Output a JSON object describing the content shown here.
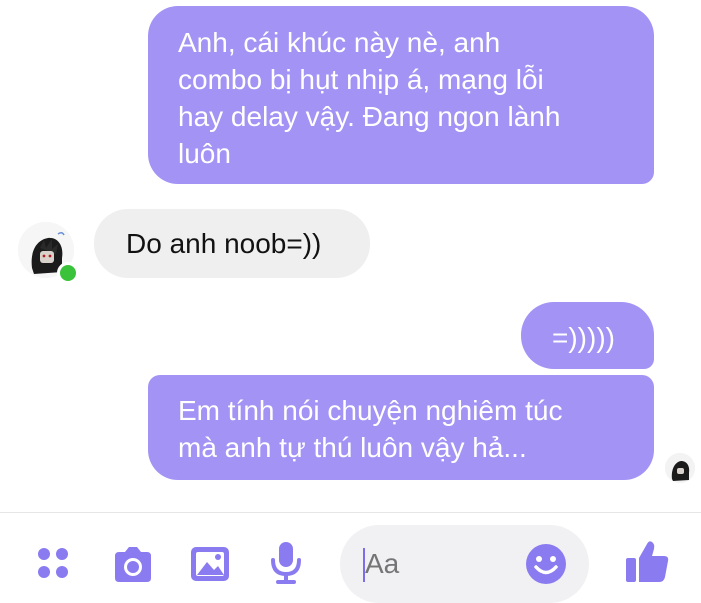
{
  "conversation": {
    "messages": [
      {
        "sender": "me",
        "text": "Anh, cái khúc này nè, anh\ncombo bị hụt nhịp á, mạng lỗi\nhay delay vậy. Đang ngon lành\nluôn"
      },
      {
        "sender": "them",
        "text": "Do anh noob=))"
      },
      {
        "sender": "me",
        "text": "=)))))"
      },
      {
        "sender": "me",
        "text": "Em tính nói chuyện nghiêm túc\nmà anh tự thú luôn vậy hả..."
      }
    ],
    "contact": {
      "online": true
    }
  },
  "composer": {
    "placeholder": "Aa",
    "icons": [
      "apps-icon",
      "camera-icon",
      "image-icon",
      "microphone-icon",
      "emoji-icon",
      "like-icon"
    ]
  },
  "colors": {
    "outgoing_bubble": "#a393f5",
    "incoming_bubble": "#efeff0",
    "accent": "#8a7bf0",
    "online": "#3ac33a"
  }
}
